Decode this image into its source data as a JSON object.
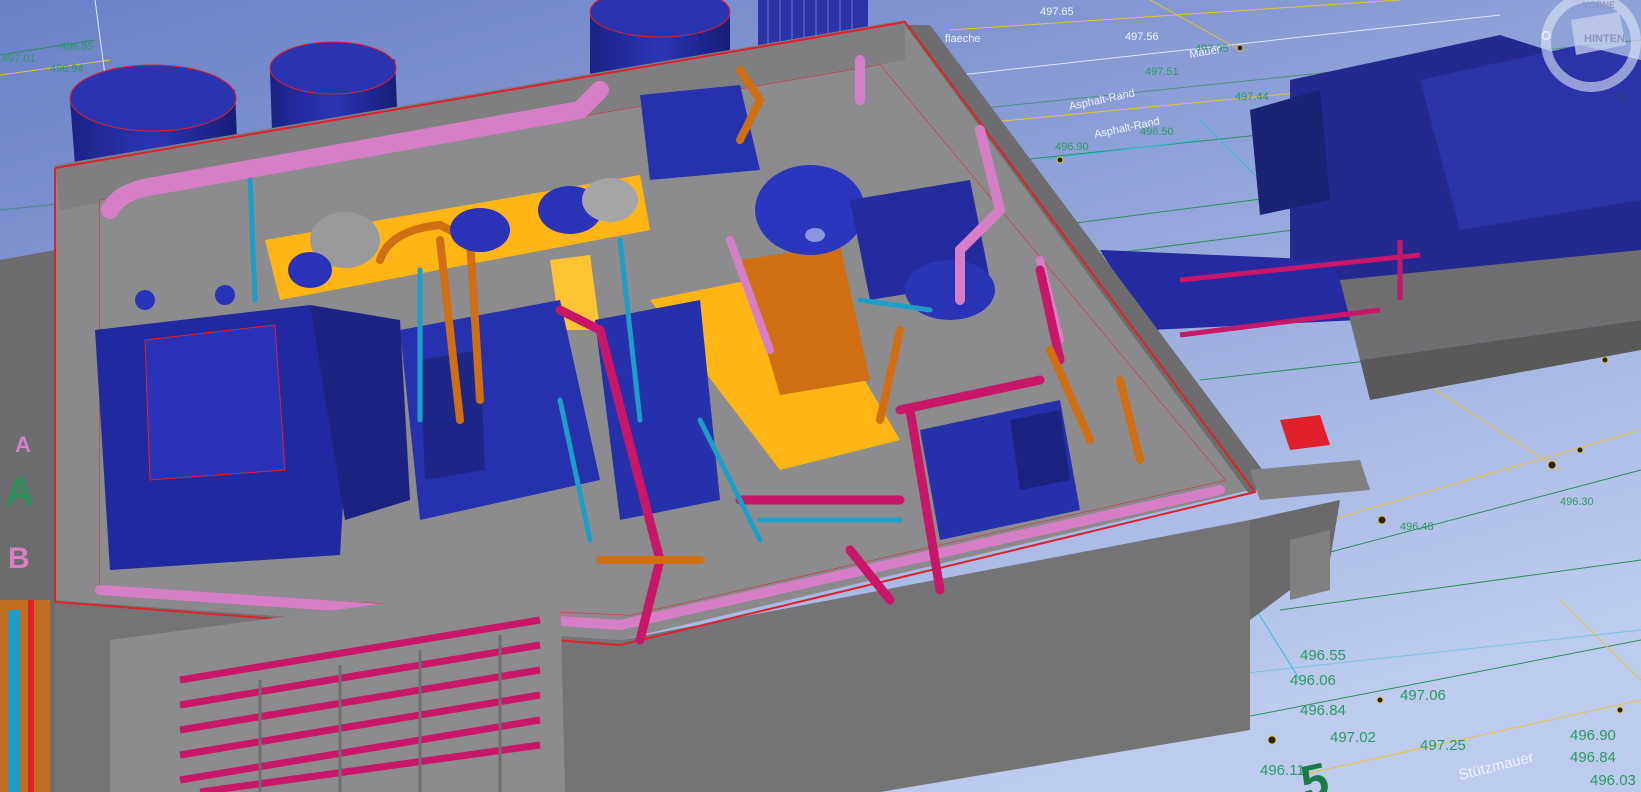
{
  "viewer": {
    "background_top": "#6f85c9",
    "background_bottom": "#b7c6ea"
  },
  "nav_cube": {
    "face_top": "VORNE",
    "face_main": "HINTEN",
    "compass_n": "N",
    "compass_o": "O"
  },
  "axis_markers": {
    "a_small": "A",
    "a_large": "A",
    "b": "B",
    "five": "5"
  },
  "survey_labels": {
    "surface": "flaeche",
    "wall_top": "Mauer",
    "asphalt_1": "Asphalt-Rand",
    "asphalt_2": "Asphalt-Rand",
    "retaining_wall": "Stützmauer",
    "heights": [
      "497.01",
      "496.94",
      "496.85",
      "497.65",
      "497.56",
      "497.51",
      "497.95",
      "496.90",
      "496.50",
      "497.44",
      "496.55",
      "496.84",
      "497.06",
      "497.02",
      "497.25",
      "496.90",
      "496.84",
      "496.06",
      "496.11",
      "496.30",
      "496.48",
      "496.03"
    ]
  },
  "colors": {
    "concrete": "#7a7a7c",
    "concrete_dark": "#5f5f61",
    "equipment_blue": "#22299a",
    "equipment_blue_light": "#3040c0",
    "duct_pink": "#d77fc6",
    "pipe_magenta": "#c81668",
    "pipe_orange": "#cf6e12",
    "pipe_cyan": "#1d9ec8",
    "platform_yellow": "#ffb514",
    "edge_red": "#e0202a",
    "survey_line": "#e8c23a",
    "survey_green": "#1d8a52"
  }
}
